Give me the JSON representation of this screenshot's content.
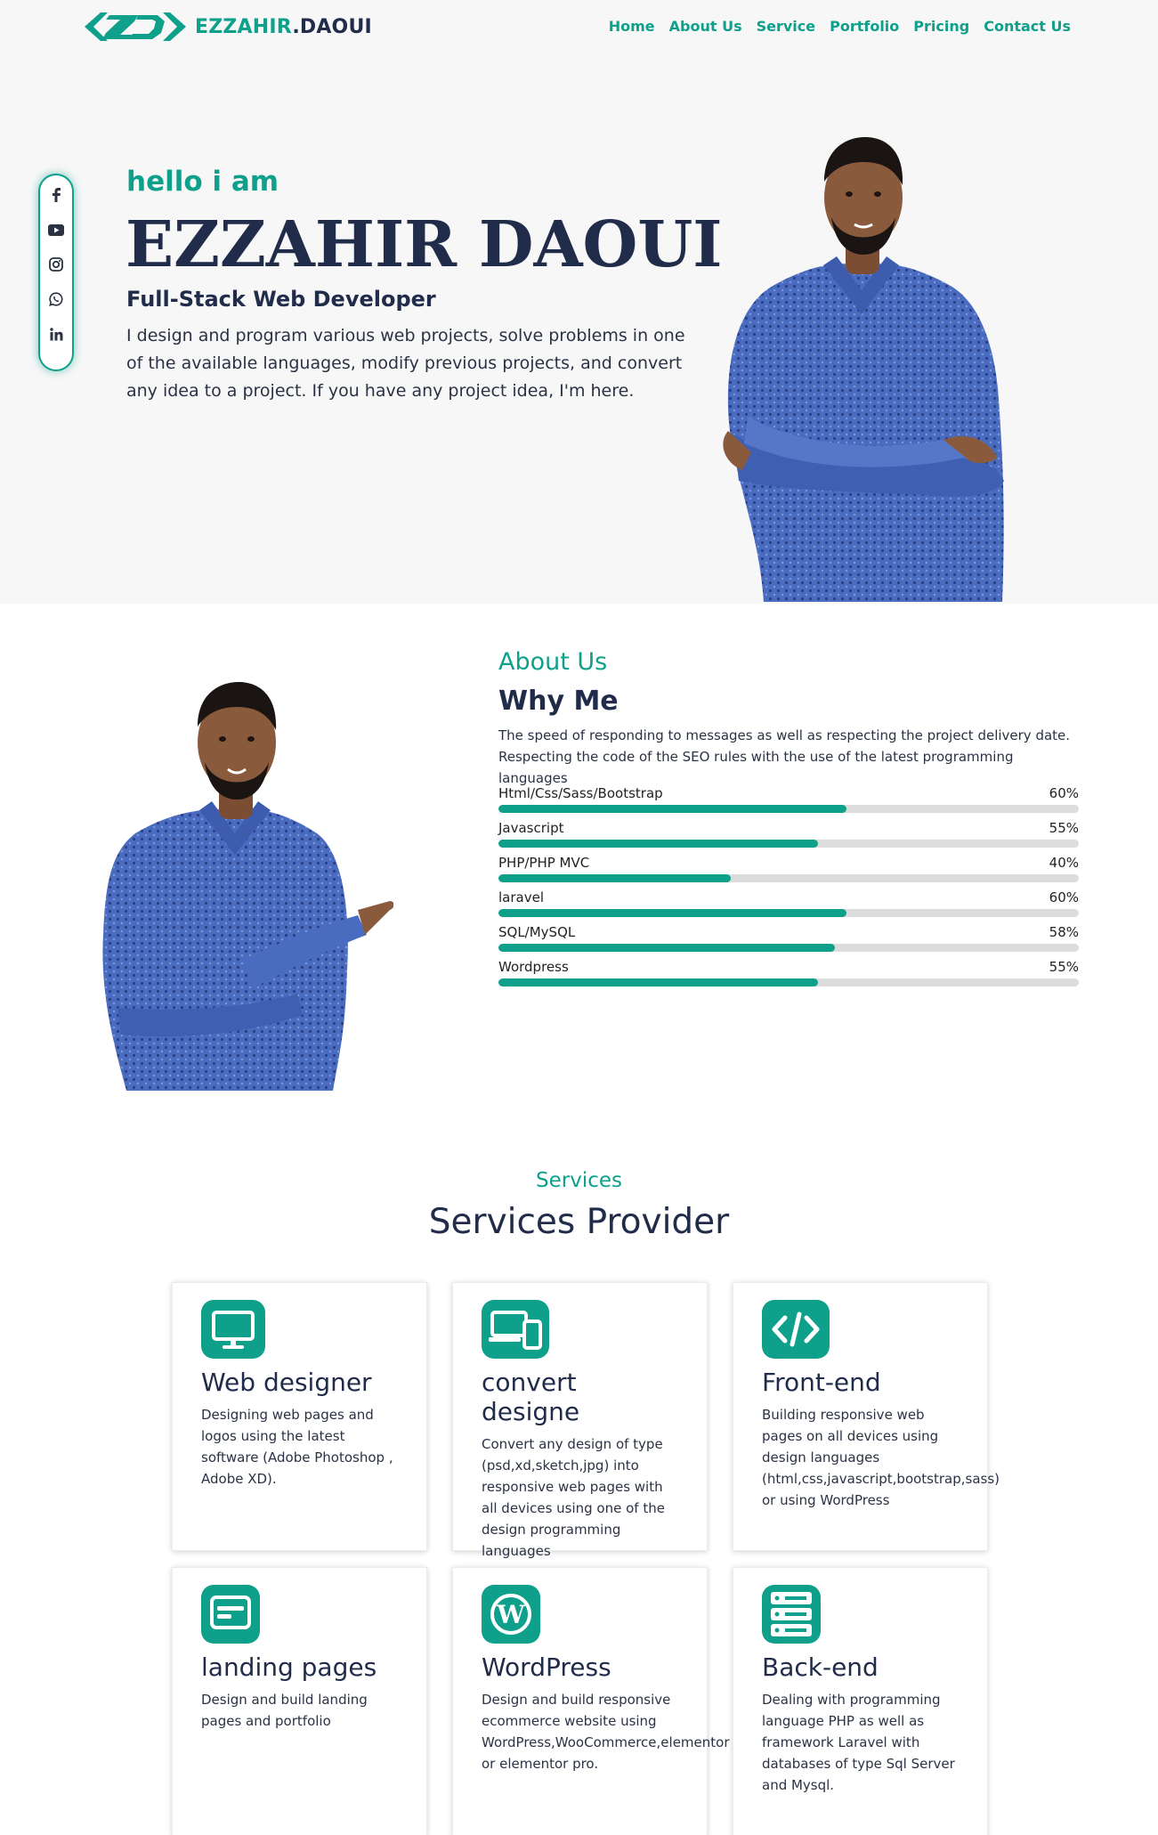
{
  "header": {
    "logo_part1": "EZZAHIR",
    "logo_part2": ".DAOUI",
    "nav": [
      "Home",
      "About Us",
      "Service",
      "Portfolio",
      "Pricing",
      "Contact Us"
    ]
  },
  "social": [
    "facebook-icon",
    "youtube-icon",
    "instagram-icon",
    "whatsapp-icon",
    "linkedin-icon"
  ],
  "hero": {
    "greeting": "hello i am",
    "name": "EZZAHIR DAOUI",
    "role": "Full-Stack Web Developer",
    "description": "I design and program various web projects, solve problems in one of the available languages, modify previous projects, and convert any idea to a project. If you have any project idea, I'm here."
  },
  "about": {
    "subtitle": "About Us",
    "title": "Why Me",
    "description": "The speed of responding to messages as well as respecting the project delivery date. Respecting the code of the SEO rules with the use of the latest programming languages",
    "skills": [
      {
        "name": "Html/Css/Sass/Bootstrap",
        "percent": "60%",
        "value": 60
      },
      {
        "name": "Javascript",
        "percent": "55%",
        "value": 55
      },
      {
        "name": "PHP/PHP MVC",
        "percent": "40%",
        "value": 40
      },
      {
        "name": "laravel",
        "percent": "60%",
        "value": 60
      },
      {
        "name": "SQL/MySQL",
        "percent": "58%",
        "value": 58
      },
      {
        "name": "Wordpress",
        "percent": "55%",
        "value": 55
      }
    ]
  },
  "services": {
    "subtitle": "Services",
    "title": "Services Provider",
    "items": [
      {
        "title": "Web designer",
        "icon": "monitor-icon",
        "description": "Designing web pages and logos using the latest software (Adobe Photoshop , Adobe XD)."
      },
      {
        "title": "convert designe",
        "icon": "devices-icon",
        "description": "Convert any design of type (psd,xd,sketch,jpg) into responsive web pages with all devices using one of the design programming languages"
      },
      {
        "title": "Front-end",
        "icon": "code-icon",
        "description": "Building responsive web pages on all devices using design languages (html,css,javascript,bootstrap,sass) or using WordPress"
      },
      {
        "title": "landing pages",
        "icon": "landing-page-icon",
        "description": "Design and build landing pages and portfolio"
      },
      {
        "title": "WordPress",
        "icon": "wordpress-icon",
        "description": "Design and build responsive ecommerce website using WordPress,WooCommerce,elementor or elementor pro."
      },
      {
        "title": "Back-end",
        "icon": "server-icon",
        "description": "Dealing with programming language PHP as well as framework Laravel with databases of type Sql Server and Mysql."
      }
    ]
  },
  "colors": {
    "accent": "#0ea08a",
    "navy": "#212c4a",
    "shirt": "#4a6cc0",
    "skin": "#8a5a3c"
  }
}
